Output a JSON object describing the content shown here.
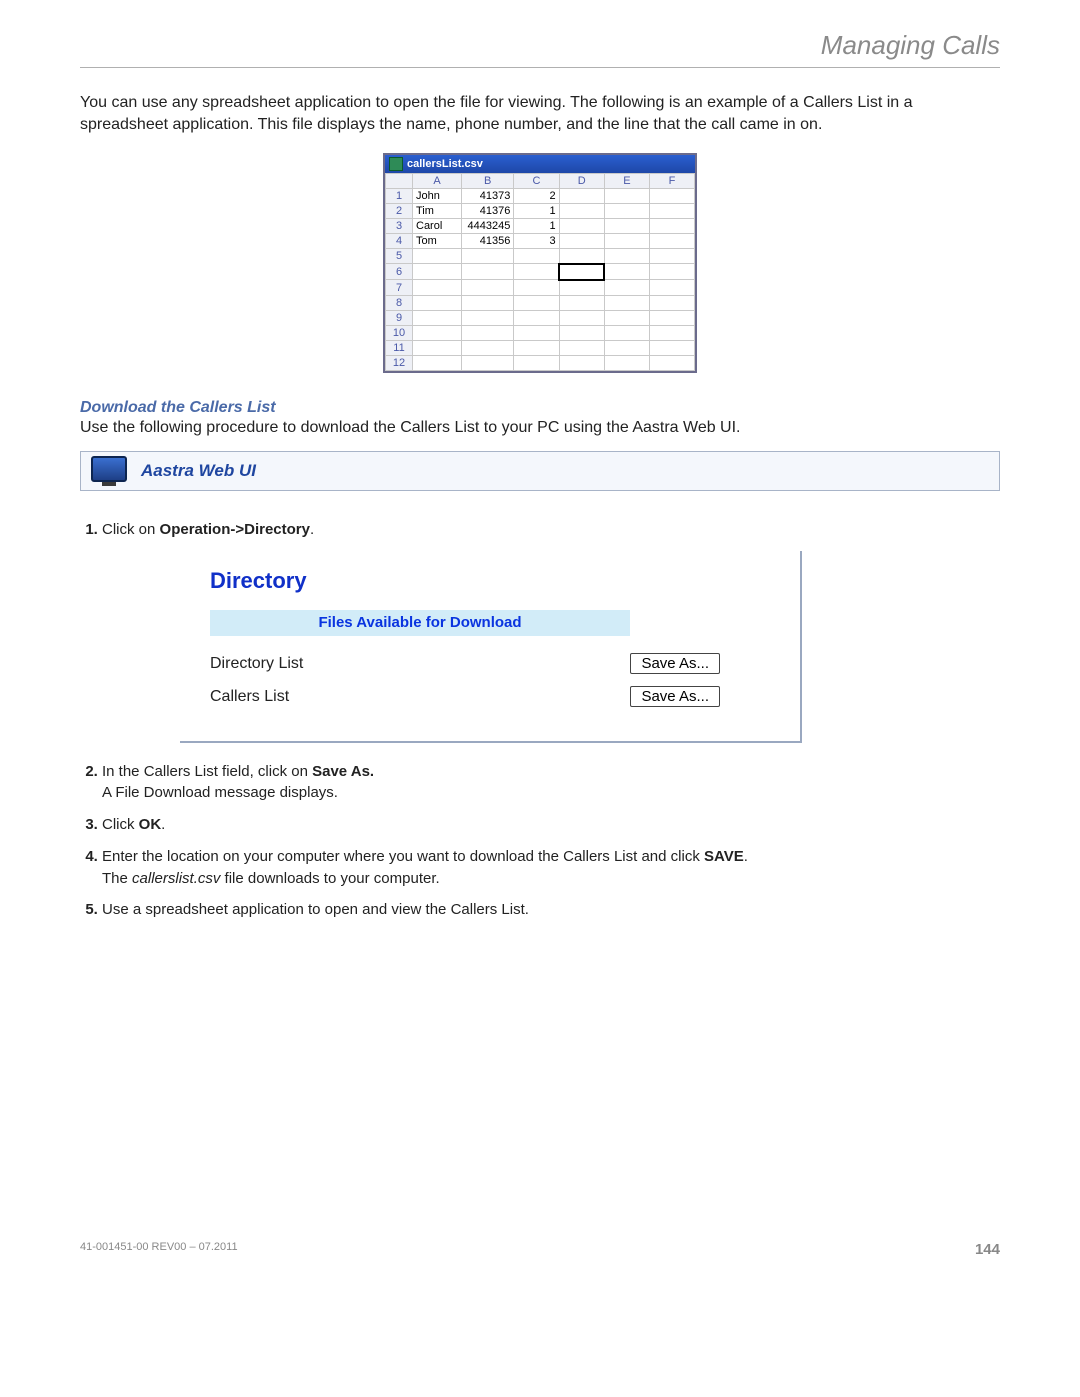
{
  "header": {
    "title": "Managing Calls"
  },
  "intro": "You can use any spreadsheet application to open the file for viewing. The following is an example of a Callers List in a spreadsheet application. This file displays the name, phone number, and the line that the call came in on.",
  "spreadsheet": {
    "filename": "callersList.csv",
    "columns": [
      "A",
      "B",
      "C",
      "D",
      "E",
      "F"
    ],
    "row_headers": [
      "1",
      "2",
      "3",
      "4",
      "5",
      "6",
      "7",
      "8",
      "9",
      "10",
      "11",
      "12"
    ],
    "data": [
      {
        "a": "John",
        "b": "41373",
        "c": "2"
      },
      {
        "a": "Tim",
        "b": "41376",
        "c": "1"
      },
      {
        "a": "Carol",
        "b": "4443245",
        "c": "1"
      },
      {
        "a": "Tom",
        "b": "41356",
        "c": "3"
      }
    ],
    "active_cell": "D6"
  },
  "section": {
    "subhead": "Download the Callers List",
    "procedure": "Use the following procedure to download the Callers List to your PC using the Aastra Web UI.",
    "banner": "Aastra Web UI"
  },
  "directory": {
    "title": "Directory",
    "files_header": "Files Available for Download",
    "rows": [
      {
        "label": "Directory List",
        "button": "Save As..."
      },
      {
        "label": "Callers List",
        "button": "Save As..."
      }
    ]
  },
  "steps": {
    "s1a": "Click on ",
    "s1b": "Operation->Directory",
    "s1c": ".",
    "s2a": "In the Callers List field, click on ",
    "s2b": "Save As.",
    "s2c": "A File Download message displays.",
    "s3a": "Click ",
    "s3b": "OK",
    "s3c": ".",
    "s4a": "Enter the location on your computer where you want to download the Callers List and click ",
    "s4b": "SAVE",
    "s4c": ".",
    "s4d": "The ",
    "s4e": "callerslist.csv",
    "s4f": " file downloads to your computer.",
    "s5": "Use a spreadsheet application to open and view the Callers List."
  },
  "footer": {
    "left": "41-001451-00 REV00 – 07.2011",
    "page": "144"
  }
}
